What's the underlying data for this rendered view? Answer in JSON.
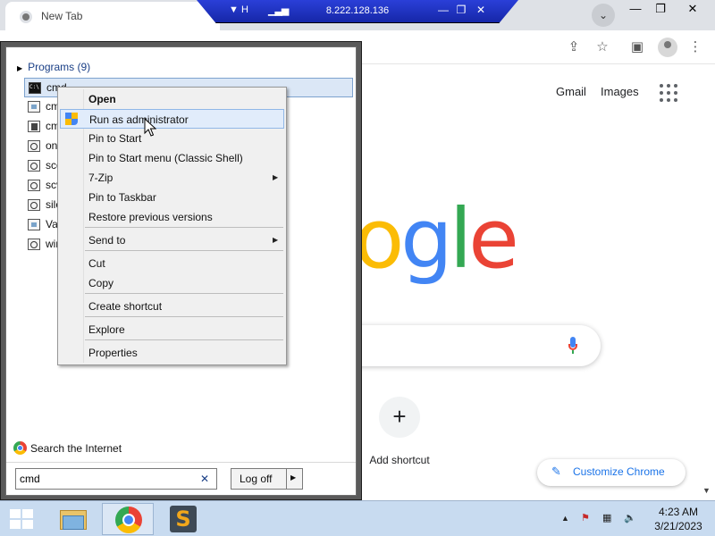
{
  "chrome": {
    "tab_title": "New Tab",
    "tab_search_glyph": "⌄",
    "window_controls": {
      "minimize": "—",
      "restore": "❐",
      "close": "✕"
    },
    "toolbar_icons": {
      "share": "⇪",
      "bookmark": "☆",
      "sidepanel": "▣",
      "menu": "⋮"
    }
  },
  "rdp": {
    "title": "8.222.128.136",
    "pin_glyph": "▼ H",
    "signal_glyph": "▁▃▅",
    "controls": {
      "minimize": "—",
      "restore": "❐",
      "close": "✕"
    }
  },
  "google": {
    "links": [
      "Gmail",
      "Images"
    ],
    "logo_text": "ogle",
    "add_shortcut_glyph": "+",
    "add_shortcut_label": "Add shortcut",
    "customize_icon": "✎",
    "customize_label": "Customize Chrome",
    "scroll_down": "▼",
    "colors": {
      "blue": "#4285f4",
      "red": "#ea4335",
      "yellow": "#fbbc05",
      "green": "#34a853",
      "accent": "#1a73e8"
    }
  },
  "start_menu": {
    "programs_header": "Programs (9)",
    "programs": [
      {
        "label": "cmd",
        "icon": "cmd"
      },
      {
        "label": "cm",
        "icon": "gen"
      },
      {
        "label": "cm",
        "icon": "shield"
      },
      {
        "label": "on",
        "icon": "search"
      },
      {
        "label": "sco",
        "icon": "search"
      },
      {
        "label": "scv",
        "icon": "search"
      },
      {
        "label": "silo",
        "icon": "search"
      },
      {
        "label": "Vac",
        "icon": "gen"
      },
      {
        "label": "win",
        "icon": "search"
      }
    ],
    "search_internet": "Search the Internet",
    "search_value": "cmd",
    "clear_glyph": "✕",
    "logoff_label": "Log off",
    "logoff_arrow": "▶"
  },
  "context_menu": {
    "items": [
      {
        "label": "Open",
        "bold": true
      },
      {
        "label": "Run as administrator",
        "hover": true,
        "shield": true
      },
      {
        "label": "Pin to Start"
      },
      {
        "label": "Pin to Start menu (Classic Shell)"
      },
      {
        "label": "7-Zip",
        "submenu": true
      },
      {
        "label": "Pin to Taskbar"
      },
      {
        "label": "Restore previous versions"
      },
      {
        "label": "Send to",
        "submenu": true
      },
      {
        "label": "Cut"
      },
      {
        "label": "Copy"
      },
      {
        "label": "Create shortcut"
      },
      {
        "label": "Explore"
      },
      {
        "label": "Properties"
      }
    ],
    "submenu_arrow": "▶"
  },
  "taskbar": {
    "s_app_letter": "S",
    "tray": {
      "expand": "▲",
      "flag": "⚑",
      "network": "▦",
      "volume": "🔈"
    },
    "time": "4:23 AM",
    "date": "3/21/2023"
  }
}
